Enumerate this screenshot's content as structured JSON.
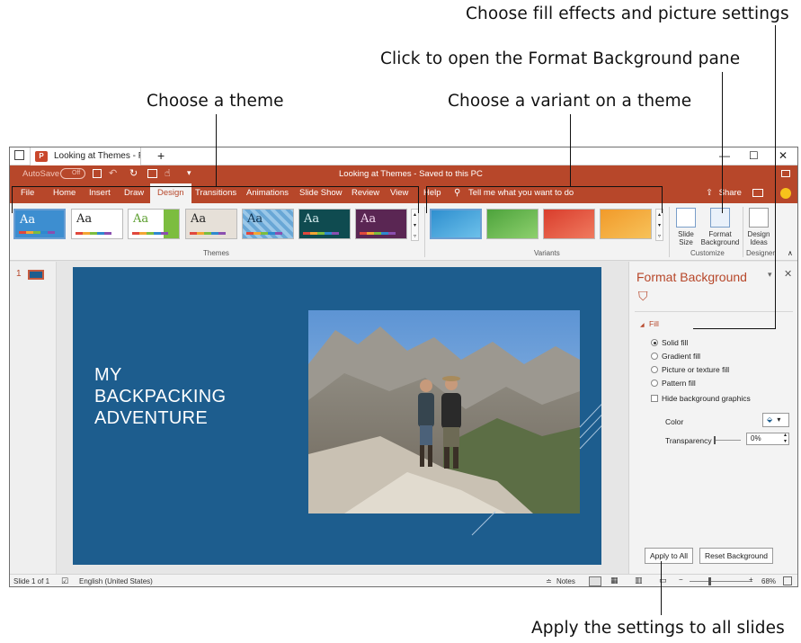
{
  "callouts": {
    "fill_effects": "Choose fill effects and picture settings",
    "format_background": "Click to open the Format Background pane",
    "theme": "Choose a theme",
    "variant": "Choose a variant on a theme",
    "apply_all": "Apply the settings to all slides"
  },
  "window": {
    "tab_title": "Looking at Themes - Pc",
    "title": "Looking at Themes - Saved to this PC",
    "autosave_label": "AutoSave",
    "autosave_state": "Off",
    "controls": {
      "minimize": "—",
      "maximize": "☐",
      "close": "✕"
    }
  },
  "ribbon_tabs": [
    "File",
    "Home",
    "Insert",
    "Draw",
    "Design",
    "Transitions",
    "Animations",
    "Slide Show",
    "Review",
    "View",
    "Help"
  ],
  "active_tab": "Design",
  "tell_me": "Tell me what you want to do",
  "share_label": "Share",
  "themes": {
    "label": "Themes",
    "items": [
      {
        "sample": "Aa",
        "bg": "#3d8ed0",
        "fg": "#ffffff"
      },
      {
        "sample": "Aa",
        "bg": "#ffffff",
        "fg": "#222222"
      },
      {
        "sample": "Aa",
        "bg": "#ffffff",
        "fg": "#5b9e2e"
      },
      {
        "sample": "Aa",
        "bg": "#e6e0d8",
        "fg": "#222222"
      },
      {
        "sample": "Aa",
        "bg": "#69a7d6",
        "fg": "#10324f"
      },
      {
        "sample": "Aa",
        "bg": "#0f4b50",
        "fg": "#d7eef0"
      },
      {
        "sample": "Aa",
        "bg": "#5a2653",
        "fg": "#f4d8ef"
      }
    ]
  },
  "variants": {
    "label": "Variants",
    "colors": [
      "#2f8fcf",
      "#4da33c",
      "#d93d2c",
      "#f19a2a"
    ]
  },
  "customize": {
    "label": "Customize",
    "slide_size": "Slide Size",
    "format_background": "Format Background"
  },
  "designer": {
    "label": "Designer",
    "design_ideas": "Design Ideas"
  },
  "slide_panel": {
    "number": "1"
  },
  "slide": {
    "title_lines": [
      "MY",
      "BACKPACKING",
      "ADVENTURE"
    ],
    "bg_color": "#1d5d8e"
  },
  "format_pane": {
    "title": "Format Background",
    "section": "Fill",
    "options": [
      {
        "label": "Solid fill",
        "type": "radio",
        "checked": true
      },
      {
        "label": "Gradient fill",
        "type": "radio",
        "checked": false
      },
      {
        "label": "Picture or texture fill",
        "type": "radio",
        "checked": false
      },
      {
        "label": "Pattern fill",
        "type": "radio",
        "checked": false
      },
      {
        "label": "Hide background graphics",
        "type": "checkbox",
        "checked": false
      }
    ],
    "color_label": "Color",
    "transparency_label": "Transparency",
    "transparency_value": "0%",
    "apply_all": "Apply to All",
    "reset": "Reset Background"
  },
  "status": {
    "slide": "Slide 1 of 1",
    "language": "English (United States)",
    "notes": "Notes",
    "zoom": "68%"
  }
}
